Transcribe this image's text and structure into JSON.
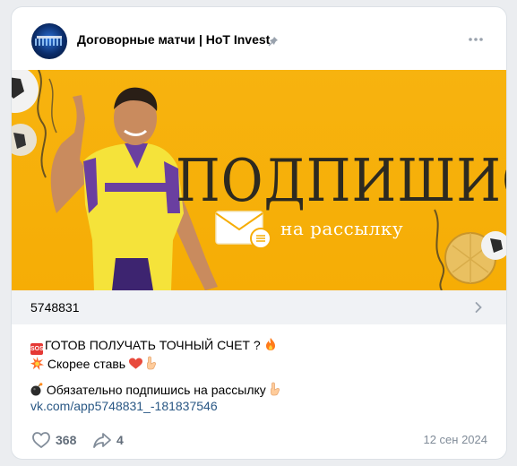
{
  "post": {
    "group_name": "Договорные матчи | HoT Invest",
    "banner": {
      "title": "ПОДПИШИСЬ",
      "subtitle": "на рассылку"
    },
    "link_bar": {
      "id": "5748831"
    },
    "lines": {
      "line1": "ГОТОВ ПОЛУЧАТЬ ТОЧНЫЙ СЧЕТ ?",
      "line2": "Скорее ставь",
      "line3": "Обязательно подпишись на рассылку"
    },
    "link": "vk.com/app5748831_-181837546",
    "likes": "368",
    "shares": "4",
    "date": "12 сен 2024"
  },
  "colors": {
    "banner_bg": "#f6ad05",
    "link": "#2a5885",
    "muted": "#818c99",
    "counts": "#626d7a"
  },
  "icons": {
    "avatar": "group-avatar",
    "pin": "pin-icon",
    "more": "more-dots-icon",
    "chevron": "chevron-right-icon",
    "sos": "sos-icon",
    "fire": "fire-icon",
    "collision": "collision-icon",
    "heart": "heart-icon",
    "point": "point-down-icon",
    "bomb": "bomb-icon",
    "like": "heart-outline-icon",
    "share": "share-arrow-icon"
  }
}
